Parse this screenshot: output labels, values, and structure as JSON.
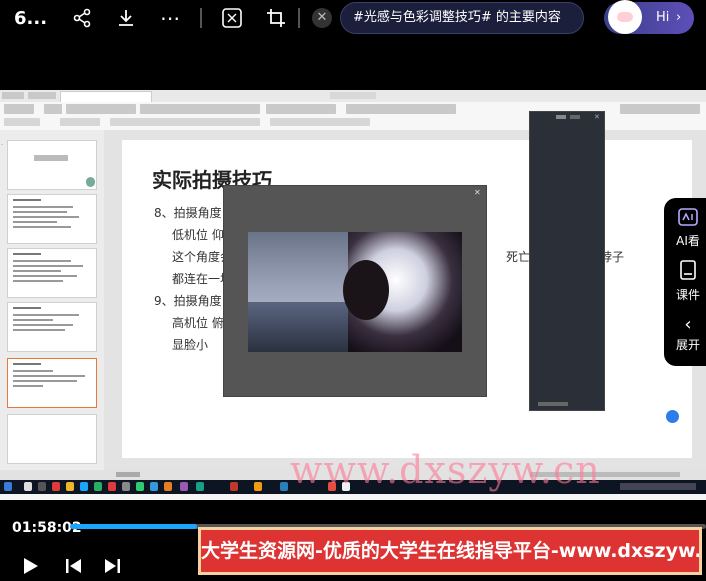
{
  "top_bar": {
    "title": "6...",
    "share_icon": "share-icon",
    "download_icon": "download-icon",
    "more_icon": "more-icon",
    "capture_icon": "screenshot-icon",
    "crop_icon": "crop-icon",
    "search_text": "#光感与色彩调整技巧# 的主要内容",
    "hi_label": "Hi",
    "chevron": "›"
  },
  "slide": {
    "title": "实际拍摄技巧",
    "line1": "8、拍摄角度",
    "line2": "低机位 仰",
    "line3a": "这个角度会",
    "line3b": "死亡的。",
    "line3c": "脖子",
    "line4": "都连在一块",
    "line5": "9、拍摄角度",
    "line6": "高机位 俯",
    "line7": "显脸小"
  },
  "side_tools": [
    {
      "icon": "ai-watch-icon",
      "label": "AI看"
    },
    {
      "icon": "courseware-icon",
      "label": "课件"
    },
    {
      "icon": "expand-icon",
      "label": "展开"
    }
  ],
  "watermark": "www.dxszyw.cn",
  "player": {
    "current_time": "01:58:02",
    "progress": 0.2
  },
  "banner": "大学生资源网-优质的大学生在线指导平台-www.dxszyw.cn",
  "colors": {
    "progress": "#1aa5ff",
    "banner_bg": "#dd3333",
    "banner_border": "#f5d2a0"
  }
}
